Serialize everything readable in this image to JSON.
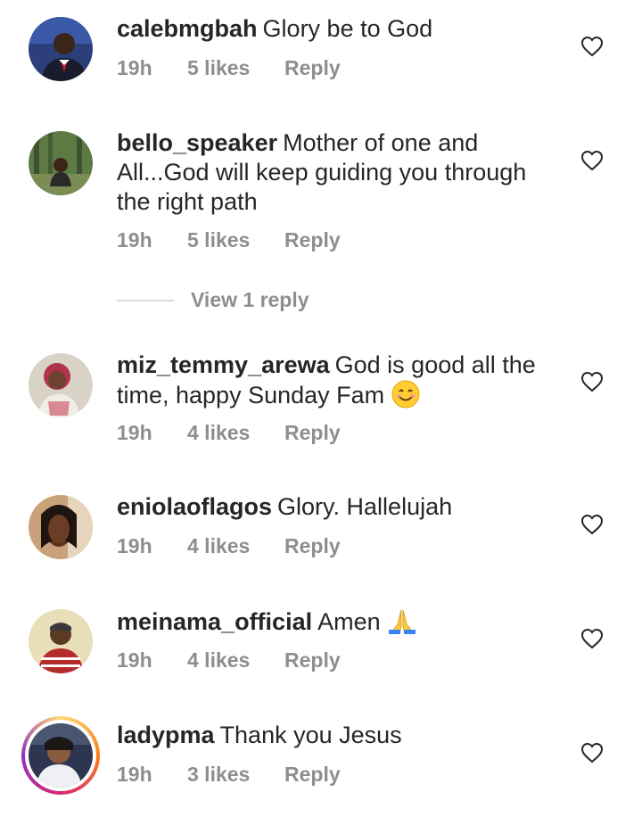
{
  "comments": [
    {
      "username": "calebmgbah",
      "text": "Glory be to God",
      "time": "19h",
      "likes": "5 likes",
      "reply": "Reply",
      "avatar": "profile-photo-man-in-suit",
      "has_story": false
    },
    {
      "username": "bello_speaker",
      "text": "Mother of one and All...God will keep guiding you through the right path",
      "time": "19h",
      "likes": "5 likes",
      "reply": "Reply",
      "avatar": "profile-photo-man-in-forest",
      "has_story": false
    },
    {
      "username": "miz_temmy_arewa",
      "text": "God is good all the time, happy Sunday Fam",
      "emoji": "smiling-face-emoji",
      "time": "19h",
      "likes": "4 likes",
      "reply": "Reply",
      "avatar": "profile-photo-woman-red-hair",
      "has_story": false
    },
    {
      "username": "eniolaoflagos",
      "text": "Glory. Hallelujah",
      "time": "19h",
      "likes": "4 likes",
      "reply": "Reply",
      "avatar": "profile-photo-woman-portrait",
      "has_story": false
    },
    {
      "username": "meinama_official",
      "text": "Amen",
      "emoji": "folded-hands-emoji",
      "time": "19h",
      "likes": "4 likes",
      "reply": "Reply",
      "avatar": "profile-photo-man-with-cap",
      "has_story": false
    },
    {
      "username": "ladypma",
      "text": "Thank you Jesus",
      "time": "19h",
      "likes": "3 likes",
      "reply": "Reply",
      "avatar": "profile-photo-woman-with-story",
      "has_story": true
    }
  ],
  "view_replies_label": "View 1 reply",
  "colors": {
    "text": "#262626",
    "secondary": "#8e8e8e",
    "divider": "#dbdbdb"
  },
  "icons": {
    "like": "heart-outline-icon"
  }
}
